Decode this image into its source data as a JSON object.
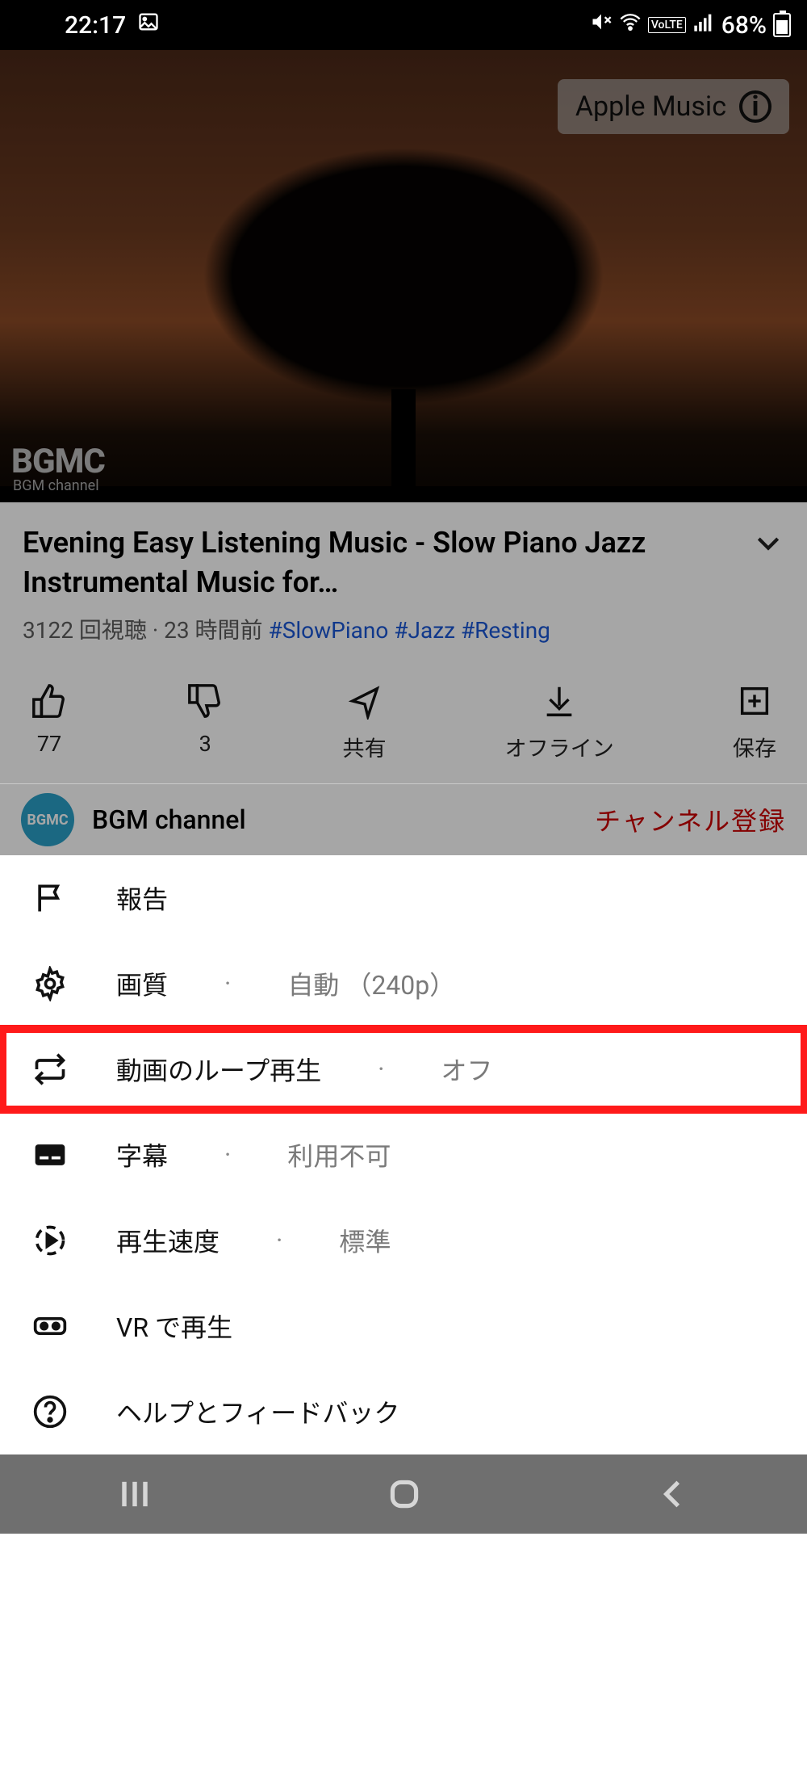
{
  "status_bar": {
    "time": "22:17",
    "battery_text": "68%",
    "indicators": [
      "mute",
      "wifi",
      "volte",
      "signal"
    ]
  },
  "video": {
    "promo_chip": "Apple Music",
    "logo_text": "BGMC",
    "logo_sub": "BGM channel"
  },
  "meta": {
    "title": "Evening Easy Listening Music - Slow Piano Jazz Instrumental Music for…",
    "views": "3122 回視聴",
    "sep": " · ",
    "age": "23 時間前",
    "hashtags": [
      "#SlowPiano",
      "#Jazz",
      "#Resting"
    ]
  },
  "actions": {
    "like": "77",
    "dislike": "3",
    "share": "共有",
    "offline": "オフライン",
    "save": "保存"
  },
  "channel": {
    "name": "BGM channel",
    "avatar_text": "BGMC",
    "subscribe": "チャンネル登録"
  },
  "sheet": {
    "report": "報告",
    "quality_label": "画質",
    "quality_value": "自動 （240p）",
    "loop_label": "動画のループ再生",
    "loop_value": "オフ",
    "captions_label": "字幕",
    "captions_value": "利用不可",
    "speed_label": "再生速度",
    "speed_value": "標準",
    "vr": "VR で再生",
    "help": "ヘルプとフィードバック"
  }
}
